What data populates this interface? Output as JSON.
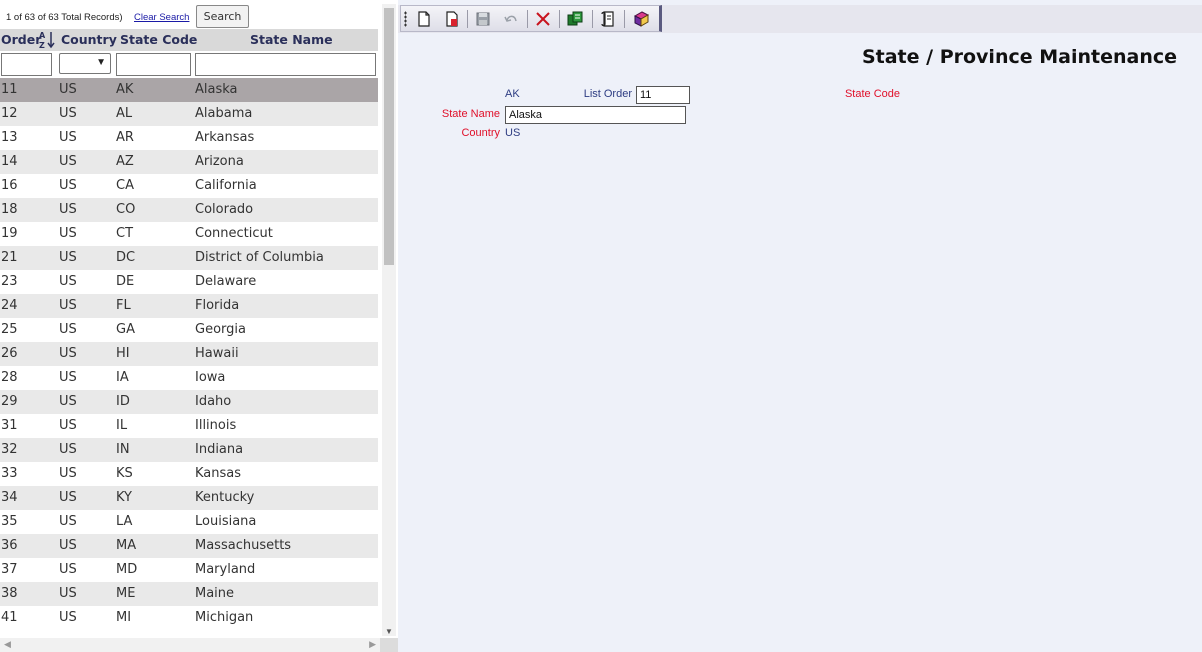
{
  "list": {
    "record_count": "1 of 63 of 63 Total Records)",
    "clear_search": "Clear Search",
    "search_button": "Search",
    "columns": {
      "order": "Order",
      "country": "Country",
      "state_code": "State Code",
      "state_name": "State Name"
    },
    "filters": {
      "order": "",
      "country": "",
      "state_code": "",
      "state_name": ""
    },
    "selected_index": 0,
    "rows": [
      {
        "order": "11",
        "country": "US",
        "code": "AK",
        "name": "Alaska"
      },
      {
        "order": "12",
        "country": "US",
        "code": "AL",
        "name": "Alabama"
      },
      {
        "order": "13",
        "country": "US",
        "code": "AR",
        "name": "Arkansas"
      },
      {
        "order": "14",
        "country": "US",
        "code": "AZ",
        "name": "Arizona"
      },
      {
        "order": "16",
        "country": "US",
        "code": "CA",
        "name": "California"
      },
      {
        "order": "18",
        "country": "US",
        "code": "CO",
        "name": "Colorado"
      },
      {
        "order": "19",
        "country": "US",
        "code": "CT",
        "name": "Connecticut"
      },
      {
        "order": "21",
        "country": "US",
        "code": "DC",
        "name": "District of Columbia"
      },
      {
        "order": "23",
        "country": "US",
        "code": "DE",
        "name": "Delaware"
      },
      {
        "order": "24",
        "country": "US",
        "code": "FL",
        "name": "Florida"
      },
      {
        "order": "25",
        "country": "US",
        "code": "GA",
        "name": "Georgia"
      },
      {
        "order": "26",
        "country": "US",
        "code": "HI",
        "name": "Hawaii"
      },
      {
        "order": "28",
        "country": "US",
        "code": "IA",
        "name": "Iowa"
      },
      {
        "order": "29",
        "country": "US",
        "code": "ID",
        "name": "Idaho"
      },
      {
        "order": "31",
        "country": "US",
        "code": "IL",
        "name": "Illinois"
      },
      {
        "order": "32",
        "country": "US",
        "code": "IN",
        "name": "Indiana"
      },
      {
        "order": "33",
        "country": "US",
        "code": "KS",
        "name": "Kansas"
      },
      {
        "order": "34",
        "country": "US",
        "code": "KY",
        "name": "Kentucky"
      },
      {
        "order": "35",
        "country": "US",
        "code": "LA",
        "name": "Louisiana"
      },
      {
        "order": "36",
        "country": "US",
        "code": "MA",
        "name": "Massachusetts"
      },
      {
        "order": "37",
        "country": "US",
        "code": "MD",
        "name": "Maryland"
      },
      {
        "order": "38",
        "country": "US",
        "code": "ME",
        "name": "Maine"
      },
      {
        "order": "41",
        "country": "US",
        "code": "MI",
        "name": "Michigan"
      }
    ]
  },
  "toolbar": {
    "buttons": [
      "new-document-icon",
      "copy-document-icon",
      "save-icon",
      "undo-icon",
      "delete-icon",
      "lookup-icon",
      "report-icon",
      "help-book-icon"
    ]
  },
  "form": {
    "title": "State / Province Maintenance",
    "state_code_label": "State Code",
    "state_code": "AK",
    "list_order_label": "List Order",
    "list_order": "11",
    "state_name_label": "State Name",
    "state_name": "Alaska",
    "country_label": "Country",
    "country": "US"
  },
  "colors": {
    "selected_row": "#aaa5a7",
    "alt_row": "#e9e9e9",
    "header_bg": "#d9d9d9",
    "label_red": "#e0102a",
    "value_blue": "#2d3c82",
    "panel_bg": "#eef1f9"
  }
}
